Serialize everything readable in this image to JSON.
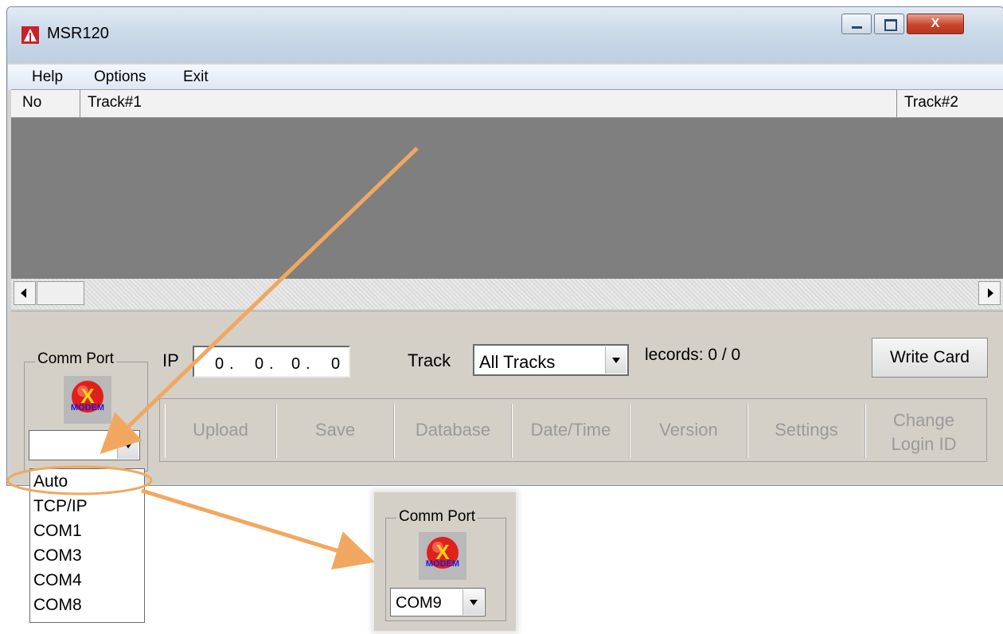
{
  "window": {
    "title": "MSR120",
    "close_glyph": "X"
  },
  "menu": [
    "Help",
    "Options",
    "Exit"
  ],
  "grid": {
    "columns": [
      "No",
      "Track#1",
      "Track#2"
    ]
  },
  "comm_port": {
    "label": "Comm Port",
    "modem_icon_text": "MODEM",
    "modem_icon_mark": "X",
    "selected": ""
  },
  "ip": {
    "label": "IP",
    "octets": [
      "0",
      "0",
      "0",
      "0"
    ]
  },
  "track": {
    "label": "Track",
    "selected": "All Tracks"
  },
  "records": {
    "text": "Records: 0 / 0",
    "visible_text": "lecords:  0 / 0"
  },
  "buttons": {
    "write_card": "Write Card",
    "upload": "Upload",
    "save": "Save",
    "database": "Database",
    "date_time": "Date/Time",
    "version": "Version",
    "settings": "Settings",
    "change_login_line1": "Change",
    "change_login_line2": "Login ID"
  },
  "dropdown_options": [
    "Auto",
    "TCP/IP",
    "COM1",
    "COM3",
    "COM4",
    "COM8"
  ],
  "inset": {
    "label": "Comm Port",
    "modem_icon_text": "MODEM",
    "selected": "COM9"
  },
  "colors": {
    "callout": "#f0a860",
    "grid_body": "#7f7f7f",
    "panel": "#d4d0c8"
  }
}
